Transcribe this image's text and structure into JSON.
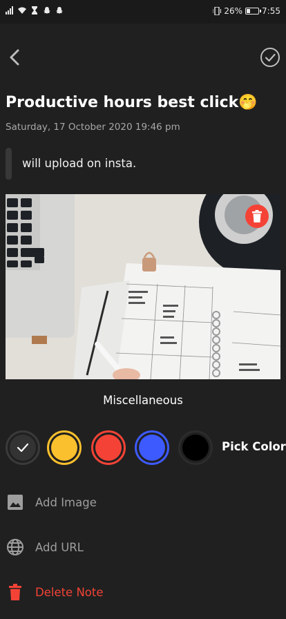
{
  "status_bar": {
    "battery": "26%",
    "time": "7:55",
    "battery_level": 0.26
  },
  "note": {
    "title": "Productive hours best click🤭",
    "date": "Saturday, 17 October 2020 19:46 pm",
    "body": "will upload on insta.",
    "category": "Miscellaneous"
  },
  "colors": {
    "options": [
      {
        "name": "dark",
        "hex": "#333333",
        "selected": true
      },
      {
        "name": "yellow",
        "hex": "#fbc02d",
        "selected": false
      },
      {
        "name": "red",
        "hex": "#f44336",
        "selected": false
      },
      {
        "name": "blue",
        "hex": "#3d5afe",
        "selected": false
      },
      {
        "name": "black",
        "hex": "#000000",
        "selected": false
      }
    ],
    "pick_label": "Pick Color"
  },
  "actions": {
    "add_image": "Add Image",
    "add_url": "Add URL",
    "delete_note": "Delete Note"
  },
  "theme": {
    "background": "#202020",
    "danger": "#f44336",
    "muted": "#9e9e9e"
  }
}
